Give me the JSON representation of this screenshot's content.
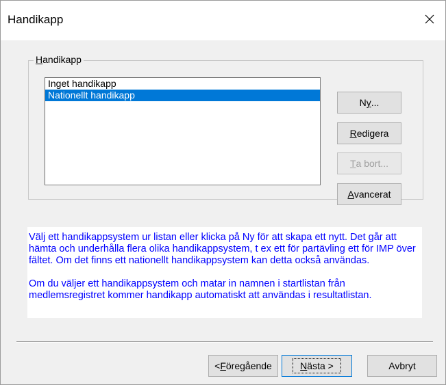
{
  "window": {
    "title": "Handikapp",
    "close_icon": "close-icon"
  },
  "group": {
    "legend_underlined": "H",
    "legend_rest": "andikapp"
  },
  "list": {
    "items": [
      {
        "label": "Inget handikapp",
        "selected": false
      },
      {
        "label": "Nationellt handikapp",
        "selected": true
      }
    ]
  },
  "side_buttons": {
    "new": {
      "pre": "N",
      "ul": "y",
      "post": "..."
    },
    "edit": {
      "pre": "",
      "ul": "R",
      "post": "edigera"
    },
    "delete": {
      "pre": "",
      "ul": "T",
      "post": "a bort...",
      "disabled": true
    },
    "advanced": {
      "pre": "",
      "ul": "A",
      "post": "vancerat"
    }
  },
  "info": {
    "paragraph1": "Välj ett handikappsystem ur listan eller klicka på Ny för att skapa ett nytt. Det går att hämta och underhålla flera olika handikappsystem, t ex ett för partävling ett för IMP över fältet. Om det finns ett nationellt handikappsystem kan detta också användas.",
    "paragraph2": "Om du väljer ett handikappsystem och matar in namnen i startlistan från medlemsregistret kommer handikapp automatiskt att användas i resultatlistan."
  },
  "footer_buttons": {
    "back": {
      "pre": "< ",
      "ul": "F",
      "post": "öregående"
    },
    "next": {
      "pre": "",
      "ul": "N",
      "post": "ästa >"
    },
    "cancel": {
      "label": "Avbryt"
    }
  },
  "colors": {
    "selection": "#0078d7",
    "info_text": "#0000ff",
    "dialog_bg": "#f0f0f0"
  }
}
